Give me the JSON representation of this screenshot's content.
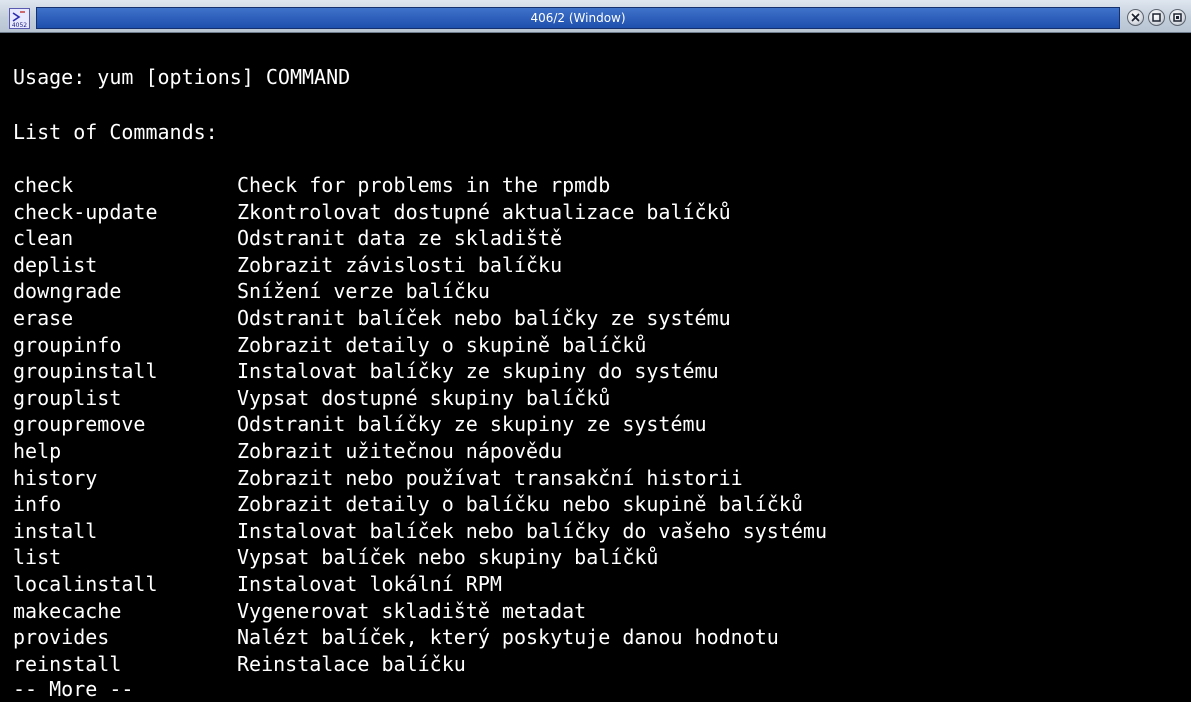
{
  "window": {
    "title": "406/2 (Window)",
    "icon_label": "4052"
  },
  "terminal": {
    "usage": "Usage: yum [options] COMMAND",
    "list_heading": "List of Commands:",
    "commands": [
      {
        "name": "check",
        "desc": "Check for problems in the rpmdb"
      },
      {
        "name": "check-update",
        "desc": "Zkontrolovat dostupné aktualizace balíčků"
      },
      {
        "name": "clean",
        "desc": "Odstranit data ze skladiště"
      },
      {
        "name": "deplist",
        "desc": "Zobrazit závislosti balíčku"
      },
      {
        "name": "downgrade",
        "desc": "Snížení verze balíčku"
      },
      {
        "name": "erase",
        "desc": "Odstranit balíček nebo balíčky ze systému"
      },
      {
        "name": "groupinfo",
        "desc": "Zobrazit detaily o skupině balíčků"
      },
      {
        "name": "groupinstall",
        "desc": "Instalovat balíčky ze skupiny do systému"
      },
      {
        "name": "grouplist",
        "desc": "Vypsat dostupné skupiny balíčků"
      },
      {
        "name": "groupremove",
        "desc": "Odstranit balíčky ze skupiny ze systému"
      },
      {
        "name": "help",
        "desc": "Zobrazit užitečnou nápovědu"
      },
      {
        "name": "history",
        "desc": "Zobrazit nebo používat transakční historii"
      },
      {
        "name": "info",
        "desc": "Zobrazit detaily o balíčku nebo skupině balíčků"
      },
      {
        "name": "install",
        "desc": "Instalovat balíček nebo balíčky do vašeho systému"
      },
      {
        "name": "list",
        "desc": "Vypsat balíček nebo skupiny balíčků"
      },
      {
        "name": "localinstall",
        "desc": "Instalovat lokální RPM"
      },
      {
        "name": "makecache",
        "desc": "Vygenerovat skladiště metadat"
      },
      {
        "name": "provides",
        "desc": "Nalézt balíček, který poskytuje danou hodnotu"
      },
      {
        "name": "reinstall",
        "desc": "Reinstalace balíčku"
      }
    ],
    "more_prompt": "-- More --"
  },
  "colors": {
    "terminal_bg": "#000000",
    "terminal_fg": "#ffffff",
    "titlebar_active": "#2a5cb8"
  },
  "icons": {
    "app": "terminal-app-icon",
    "close": "close-icon",
    "maximize": "maximize-icon",
    "shade": "shade-icon"
  }
}
